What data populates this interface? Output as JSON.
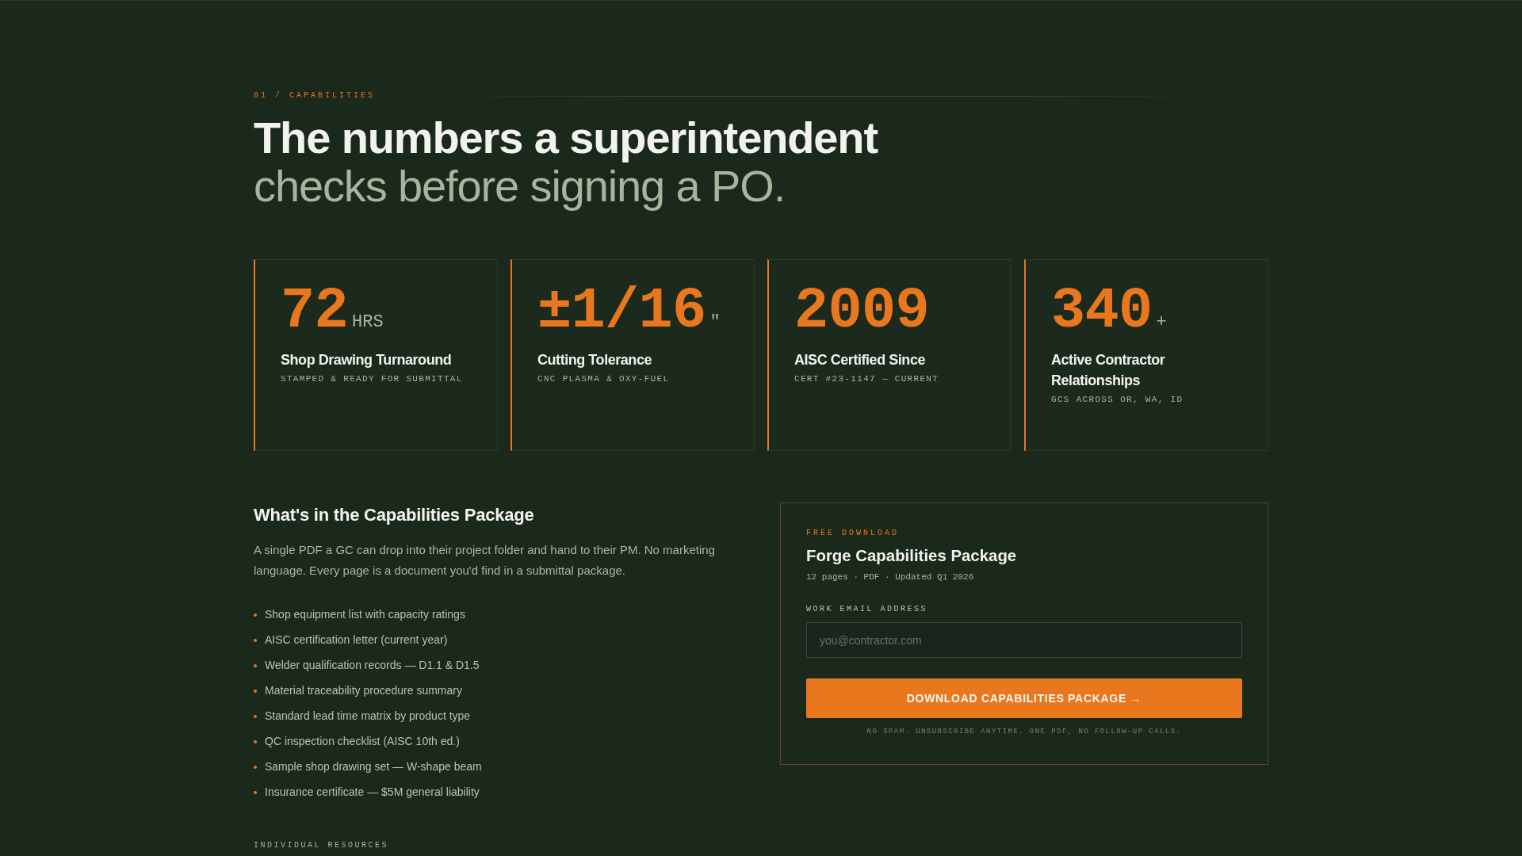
{
  "section": {
    "eyebrow": "01 / CAPABILITIES",
    "headline": "**The numbers a superintendent** checks before signing a PO."
  },
  "stats": [
    {
      "value": "72",
      "unit": "HRS",
      "label": "Shop Drawing Turnaround",
      "detail": "STAMPED & READY FOR SUBMITTAL"
    },
    {
      "value": "±1/16",
      "unit": "\"",
      "label": "Cutting Tolerance",
      "detail": "CNC PLASMA & OXY-FUEL"
    },
    {
      "value": "2009",
      "label": "AISC Certified Since",
      "detail": "CERT #23-1147 — CURRENT"
    },
    {
      "value": "340",
      "unit": "+",
      "label": "Active Contractor Relationships",
      "detail": "GCS ACROSS OR, WA, ID"
    }
  ],
  "package": {
    "title": "What's in the Capabilities Package",
    "description": "A single PDF a GC can drop into their project folder and hand to their PM. No marketing language. Every page is a document you'd find in a submittal package.",
    "items": [
      "Shop equipment list with capacity ratings",
      "AISC certification letter (current year)",
      "Welder qualification records — D1.1 & D1.5",
      "Material traceability procedure summary",
      "Standard lead time matrix by product type",
      "QC inspection checklist (AISC 10th ed.)",
      "Sample shop drawing set — W-shape beam",
      "Insurance certificate — $5M general liability"
    ],
    "resources_label": "INDIVIDUAL RESOURCES"
  },
  "download": {
    "eyebrow": "FREE DOWNLOAD",
    "title": "Forge Capabilities Package",
    "meta": "12 pages · PDF · Updated Q1 2026",
    "email": {
      "label": "WORK EMAIL ADDRESS",
      "placeholder": "you@contractor.com"
    },
    "button": "DOWNLOAD CAPABILITIES PACKAGE →",
    "note": "NO SPAM. UNSUBSCRIBE ANYTIME. ONE PDF, NO FOLLOW-UP CALLS."
  }
}
